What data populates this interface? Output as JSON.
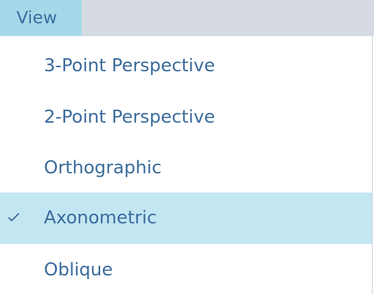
{
  "menubar": {
    "view_label": "View"
  },
  "menu": {
    "items": [
      {
        "label": "3-Point Perspective",
        "checked": false
      },
      {
        "label": "2-Point Perspective",
        "checked": false
      },
      {
        "label": "Orthographic",
        "checked": false
      },
      {
        "label": "Axonometric",
        "checked": true
      },
      {
        "label": "Oblique",
        "checked": false
      }
    ],
    "check_icon": "checkmark-icon",
    "colors": {
      "text": "#3b6c9c",
      "menubar_bg": "#d6dbe3",
      "active_menu_bg": "#a5d9ea",
      "selected_item_bg": "#c3e6f3"
    }
  }
}
